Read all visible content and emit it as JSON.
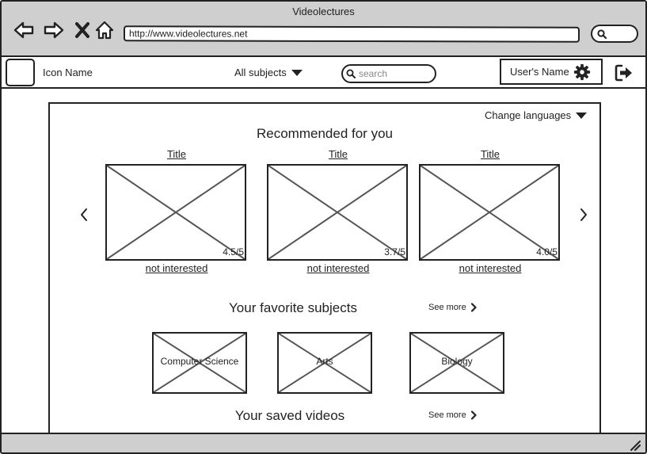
{
  "window": {
    "title": "Videolectures"
  },
  "browser": {
    "url": "http://www.videolectures.net",
    "icons": [
      "back-icon",
      "forward-icon",
      "close-icon",
      "home-icon",
      "search-icon"
    ]
  },
  "header": {
    "icon_name": "Icon Name",
    "subjects_label": "All subjects",
    "search_placeholder": "search",
    "user_name": "User's Name",
    "icons": [
      "gear-icon",
      "logout-icon"
    ]
  },
  "main": {
    "language_label": "Change languages",
    "recommended": {
      "title": "Recommended for you",
      "videos": [
        {
          "title": "Title",
          "rating": "4.5/5",
          "action": "not interested"
        },
        {
          "title": "Title",
          "rating": "3.7/5",
          "action": "not interested"
        },
        {
          "title": "Title",
          "rating": "4.0/5",
          "action": "not interested"
        }
      ]
    },
    "favorites": {
      "title": "Your favorite subjects",
      "see_more": "See more",
      "subjects": [
        "Computer Science",
        "Arts",
        "Biology"
      ]
    },
    "saved": {
      "title": "Your saved videos",
      "see_more": "See more"
    }
  },
  "colors": {
    "chrome": "#cfcfcf",
    "stroke": "#222222",
    "placeholder_x": "#555555"
  }
}
